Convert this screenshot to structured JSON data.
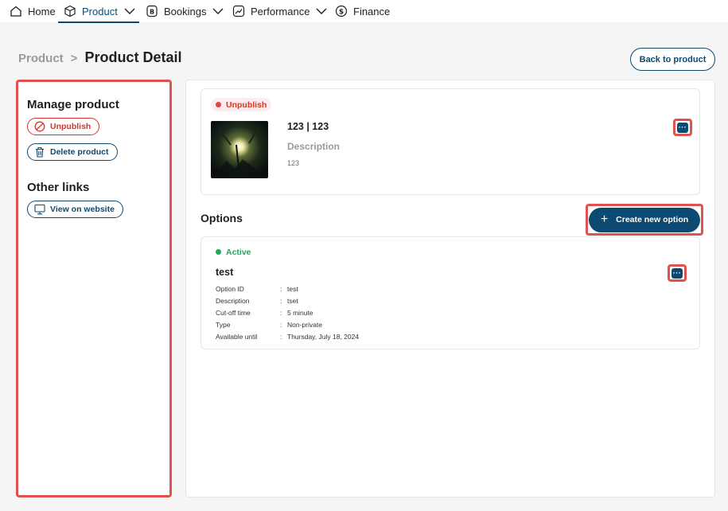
{
  "nav": {
    "items": [
      {
        "label": "Home",
        "icon": "home-icon"
      },
      {
        "label": "Product",
        "icon": "box-icon",
        "has_dropdown": true,
        "active": true
      },
      {
        "label": "Bookings",
        "icon": "bookings-icon",
        "has_dropdown": true
      },
      {
        "label": "Performance",
        "icon": "trend-icon",
        "has_dropdown": true
      },
      {
        "label": "Finance",
        "icon": "dollar-icon"
      }
    ]
  },
  "breadcrumb": {
    "root": "Product",
    "separator": ">",
    "current": "Product Detail"
  },
  "header": {
    "back_label": "Back to product"
  },
  "sidebar": {
    "manage_title": "Manage product",
    "unpublish_label": "Unpublish",
    "delete_label": "Delete product",
    "links_title": "Other links",
    "view_label": "View on website"
  },
  "product": {
    "status": "Unpublish",
    "title": "123 | 123",
    "description_label": "Description",
    "description": "123"
  },
  "options": {
    "title": "Options",
    "create_label": "Create new option",
    "items": [
      {
        "status": "Active",
        "name": "test",
        "details": [
          {
            "key": "Option ID",
            "value": "test"
          },
          {
            "key": "Description",
            "value": "tset"
          },
          {
            "key": "Cut-off time",
            "value": "5 minute"
          },
          {
            "key": "Type",
            "value": "Non-private"
          },
          {
            "key": "Available until",
            "value": "Thursday, July 18, 2024"
          }
        ]
      }
    ]
  },
  "colors": {
    "primary": "#0d4a72",
    "danger": "#d9342b",
    "success": "#1fa85a",
    "highlight": "#e0524f"
  }
}
